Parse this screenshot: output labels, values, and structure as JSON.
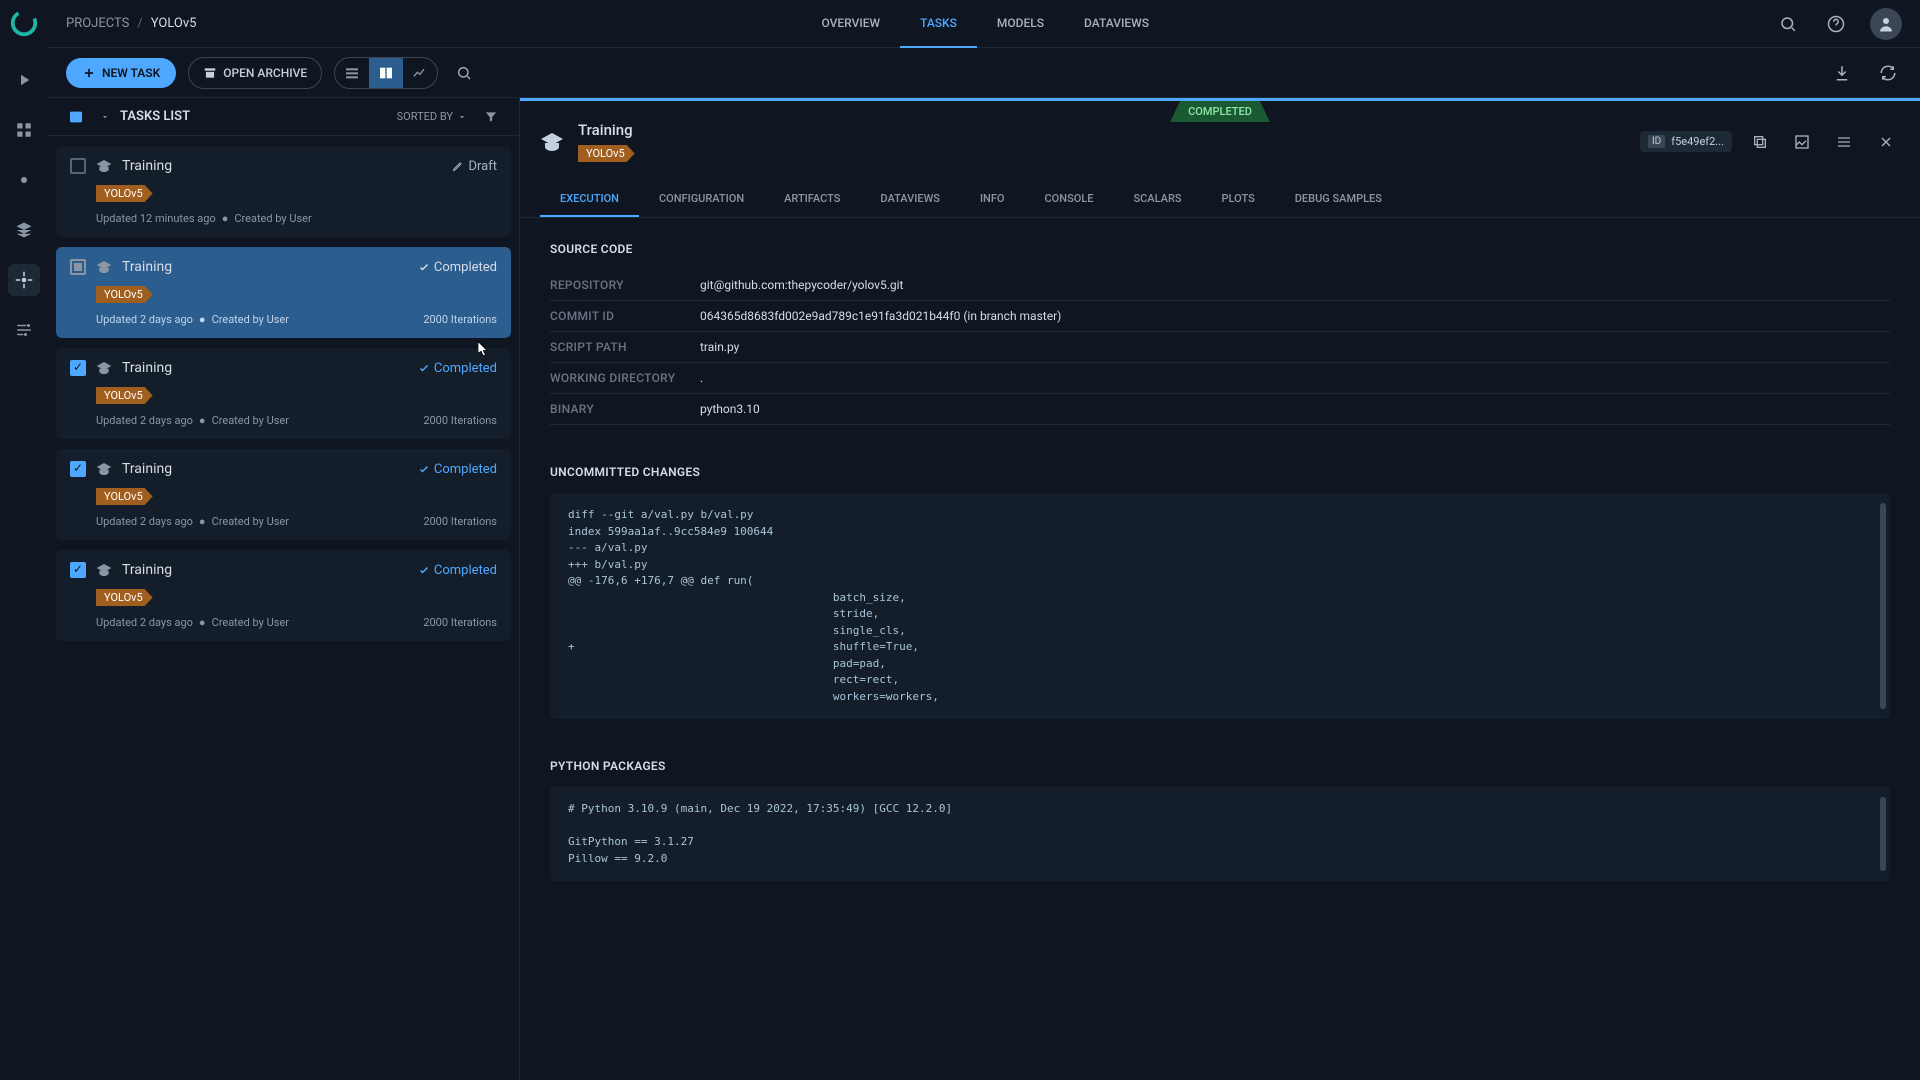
{
  "breadcrumb": {
    "root": "PROJECTS",
    "current": "YOLOv5"
  },
  "topnav": [
    "OVERVIEW",
    "TASKS",
    "MODELS",
    "DATAVIEWS"
  ],
  "toolbar": {
    "new_task": "NEW TASK",
    "open_archive": "OPEN ARCHIVE"
  },
  "list": {
    "title": "TASKS LIST",
    "sorted_by": "SORTED BY",
    "items": [
      {
        "name": "Training",
        "status": "Draft",
        "tag": "YOLOv5",
        "updated": "Updated 12 minutes ago",
        "created": "Created by User",
        "iterations": ""
      },
      {
        "name": "Training",
        "status": "Completed",
        "tag": "YOLOv5",
        "updated": "Updated 2 days ago",
        "created": "Created by User",
        "iterations": "2000 Iterations"
      },
      {
        "name": "Training",
        "status": "Completed",
        "tag": "YOLOv5",
        "updated": "Updated 2 days ago",
        "created": "Created by User",
        "iterations": "2000 Iterations"
      },
      {
        "name": "Training",
        "status": "Completed",
        "tag": "YOLOv5",
        "updated": "Updated 2 days ago",
        "created": "Created by User",
        "iterations": "2000 Iterations"
      },
      {
        "name": "Training",
        "status": "Completed",
        "tag": "YOLOv5",
        "updated": "Updated 2 days ago",
        "created": "Created by User",
        "iterations": "2000 Iterations"
      }
    ]
  },
  "detail": {
    "title": "Training",
    "tag": "YOLOv5",
    "status": "COMPLETED",
    "id_label": "ID",
    "id_value": "f5e49ef2...",
    "tabs": [
      "EXECUTION",
      "CONFIGURATION",
      "ARTIFACTS",
      "DATAVIEWS",
      "INFO",
      "CONSOLE",
      "SCALARS",
      "PLOTS",
      "DEBUG SAMPLES"
    ],
    "source_code": {
      "title": "SOURCE CODE",
      "rows": [
        {
          "k": "REPOSITORY",
          "v": "git@github.com:thepycoder/yolov5.git"
        },
        {
          "k": "COMMIT ID",
          "v": "064365d8683fd002e9ad789c1e91fa3d021b44f0 (in branch master)"
        },
        {
          "k": "SCRIPT PATH",
          "v": "train.py"
        },
        {
          "k": "WORKING DIRECTORY",
          "v": "."
        },
        {
          "k": "BINARY",
          "v": "python3.10"
        }
      ]
    },
    "uncommitted": {
      "title": "UNCOMMITTED CHANGES",
      "code": "diff --git a/val.py b/val.py\nindex 599aa1af..9cc584e9 100644\n--- a/val.py\n+++ b/val.py\n@@ -176,6 +176,7 @@ def run(\n                                        batch_size,\n                                        stride,\n                                        single_cls,\n+                                       shuffle=True,\n                                        pad=pad,\n                                        rect=rect,\n                                        workers=workers,"
    },
    "packages": {
      "title": "PYTHON PACKAGES",
      "code": "# Python 3.10.9 (main, Dec 19 2022, 17:35:49) [GCC 12.2.0]\n\nGitPython == 3.1.27\nPillow == 9.2.0"
    }
  }
}
